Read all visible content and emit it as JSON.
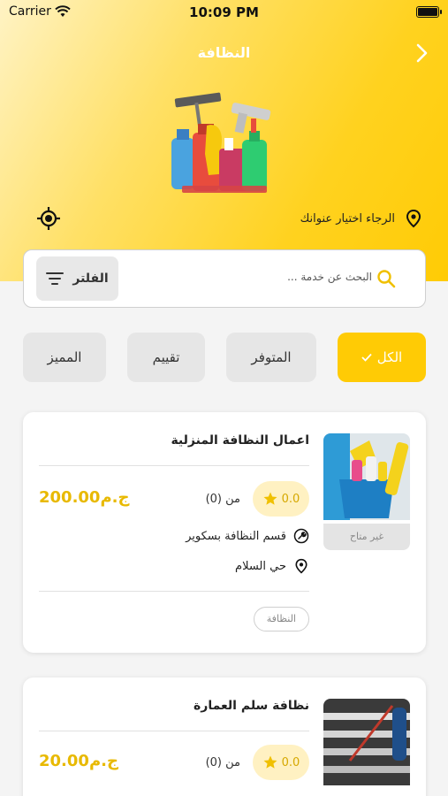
{
  "status_bar": {
    "carrier": "Carrier",
    "time": "10:09 PM"
  },
  "header": {
    "title": "النظافة",
    "address_prompt": "الرجاء اختيار عنوانك"
  },
  "search": {
    "placeholder": "البحث عن خدمة ...",
    "filter_label": "الفلتر"
  },
  "chips": [
    {
      "label": "الكل",
      "active": true
    },
    {
      "label": "المتوفر",
      "active": false
    },
    {
      "label": "تقييم",
      "active": false
    },
    {
      "label": "المميز",
      "active": false
    }
  ],
  "services": [
    {
      "name": "اعمال النظافة المنزلية",
      "rating": "0.0",
      "reviews": "من (0)",
      "price": "200.00ج.م",
      "availability": "غير متاح",
      "department": "قسم النظافة بسكوير",
      "area": "حي السلام",
      "tag": "النظافة"
    },
    {
      "name": "نظافة سلم العمارة",
      "rating": "0.0",
      "reviews": "من (0)",
      "price": "20.00ج.م"
    }
  ],
  "colors": {
    "accent": "#ffcb05",
    "price": "#e8b900",
    "star_bg": "#fff1c2"
  },
  "icons": [
    "wifi-icon",
    "battery-icon",
    "back-arrow-icon",
    "location-pin-icon",
    "crosshair-icon",
    "search-icon",
    "filter-icon",
    "check-icon",
    "star-icon",
    "wrench-icon"
  ]
}
